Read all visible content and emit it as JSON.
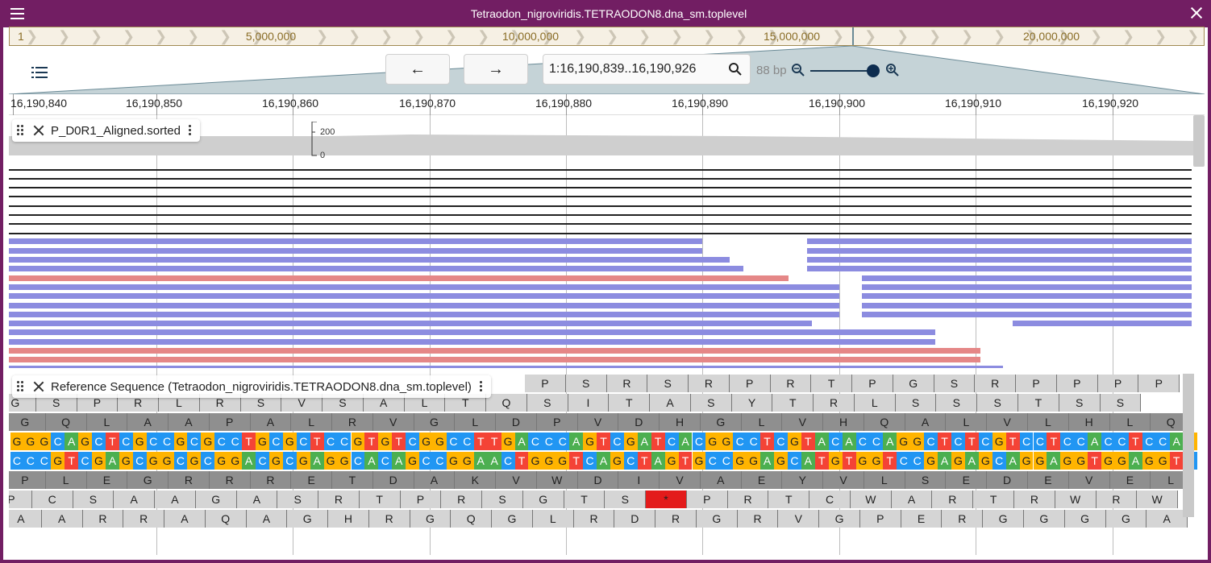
{
  "window": {
    "title": "Tetraodon_nigroviridis.TETRAODON8.dna_sm.toplevel"
  },
  "overview": {
    "labels": [
      "1",
      "5,000,000",
      "10,000,000",
      "15,000,000",
      "20,000,000"
    ]
  },
  "controls": {
    "back_arrow": "←",
    "forward_arrow": "→",
    "locstring": "1:16,190,839..16,190,926",
    "bp_label": "88 bp",
    "zoom_level": 0.92
  },
  "ruler": {
    "labels": [
      "16,190,840",
      "16,190,850",
      "16,190,860",
      "16,190,870",
      "16,190,880",
      "16,190,890",
      "16,190,900",
      "16,190,910",
      "16,190,920"
    ]
  },
  "alignments_track": {
    "name": "P_D0R1_Aligned.sorted",
    "coverage_scale": [
      "200",
      "0"
    ]
  },
  "reference_track": {
    "name": "Reference Sequence (Tetraodon_nigroviridis.TETRAODON8.dna_sm.toplevel)",
    "forward_strand": "GGGCAGCTCGCCGCGCCTGCGCTCCGTGTCGGCCTTGACCCAGTCGATCACGGCCTCGTACACCAGGCTCTCGTCCTCCACCTCCAG",
    "reverse_strand": "CCCGTCGAGCGGCGCGGACGCGAGGCACAGCCGGAACTGGGTCAGCTAGTGCCGGAGCATGTGGTCCGAGAGCAGGAGGTGGAGGTC",
    "frame_f3": [
      "P",
      "S",
      "R",
      "S",
      "R",
      "P",
      "R",
      "T",
      "P",
      "G",
      "S",
      "R",
      "P",
      "P",
      "P",
      "P"
    ],
    "frame_f2": [
      "G",
      "S",
      "P",
      "R",
      "L",
      "R",
      "S",
      "V",
      "S",
      "A",
      "L",
      "T",
      "Q",
      "S",
      "I",
      "T",
      "A",
      "S",
      "Y",
      "T",
      "R",
      "L",
      "S",
      "S",
      "S",
      "T",
      "S",
      "S"
    ],
    "frame_f1": [
      "G",
      "Q",
      "L",
      "A",
      "A",
      "P",
      "A",
      "L",
      "R",
      "V",
      "G",
      "L",
      "D",
      "P",
      "V",
      "D",
      "H",
      "G",
      "L",
      "V",
      "H",
      "Q",
      "A",
      "L",
      "V",
      "L",
      "H",
      "L",
      "Q"
    ],
    "frame_r1": [
      "P",
      "L",
      "E",
      "G",
      "R",
      "R",
      "R",
      "E",
      "T",
      "D",
      "A",
      "K",
      "V",
      "W",
      "D",
      "I",
      "V",
      "A",
      "E",
      "Y",
      "V",
      "L",
      "S",
      "E",
      "D",
      "E",
      "V",
      "E",
      "L"
    ],
    "frame_r2": [
      "P",
      "C",
      "S",
      "A",
      "A",
      "G",
      "A",
      "S",
      "R",
      "T",
      "P",
      "R",
      "S",
      "G",
      "T",
      "S",
      "*",
      "P",
      "R",
      "T",
      "C",
      "W",
      "A",
      "R",
      "T",
      "R",
      "W",
      "R",
      "W"
    ],
    "frame_r3": [
      "A",
      "A",
      "R",
      "R",
      "A",
      "Q",
      "A",
      "G",
      "H",
      "R",
      "G",
      "Q",
      "G",
      "L",
      "R",
      "D",
      "R",
      "G",
      "R",
      "V",
      "G",
      "P",
      "E",
      "R",
      "G",
      "G",
      "G",
      "G",
      "A"
    ]
  },
  "colors": {
    "frame": "#721e63",
    "read_forward": "#8c8ce0",
    "read_reverse": "#e58787",
    "stop_codon": "#e31b1b"
  }
}
